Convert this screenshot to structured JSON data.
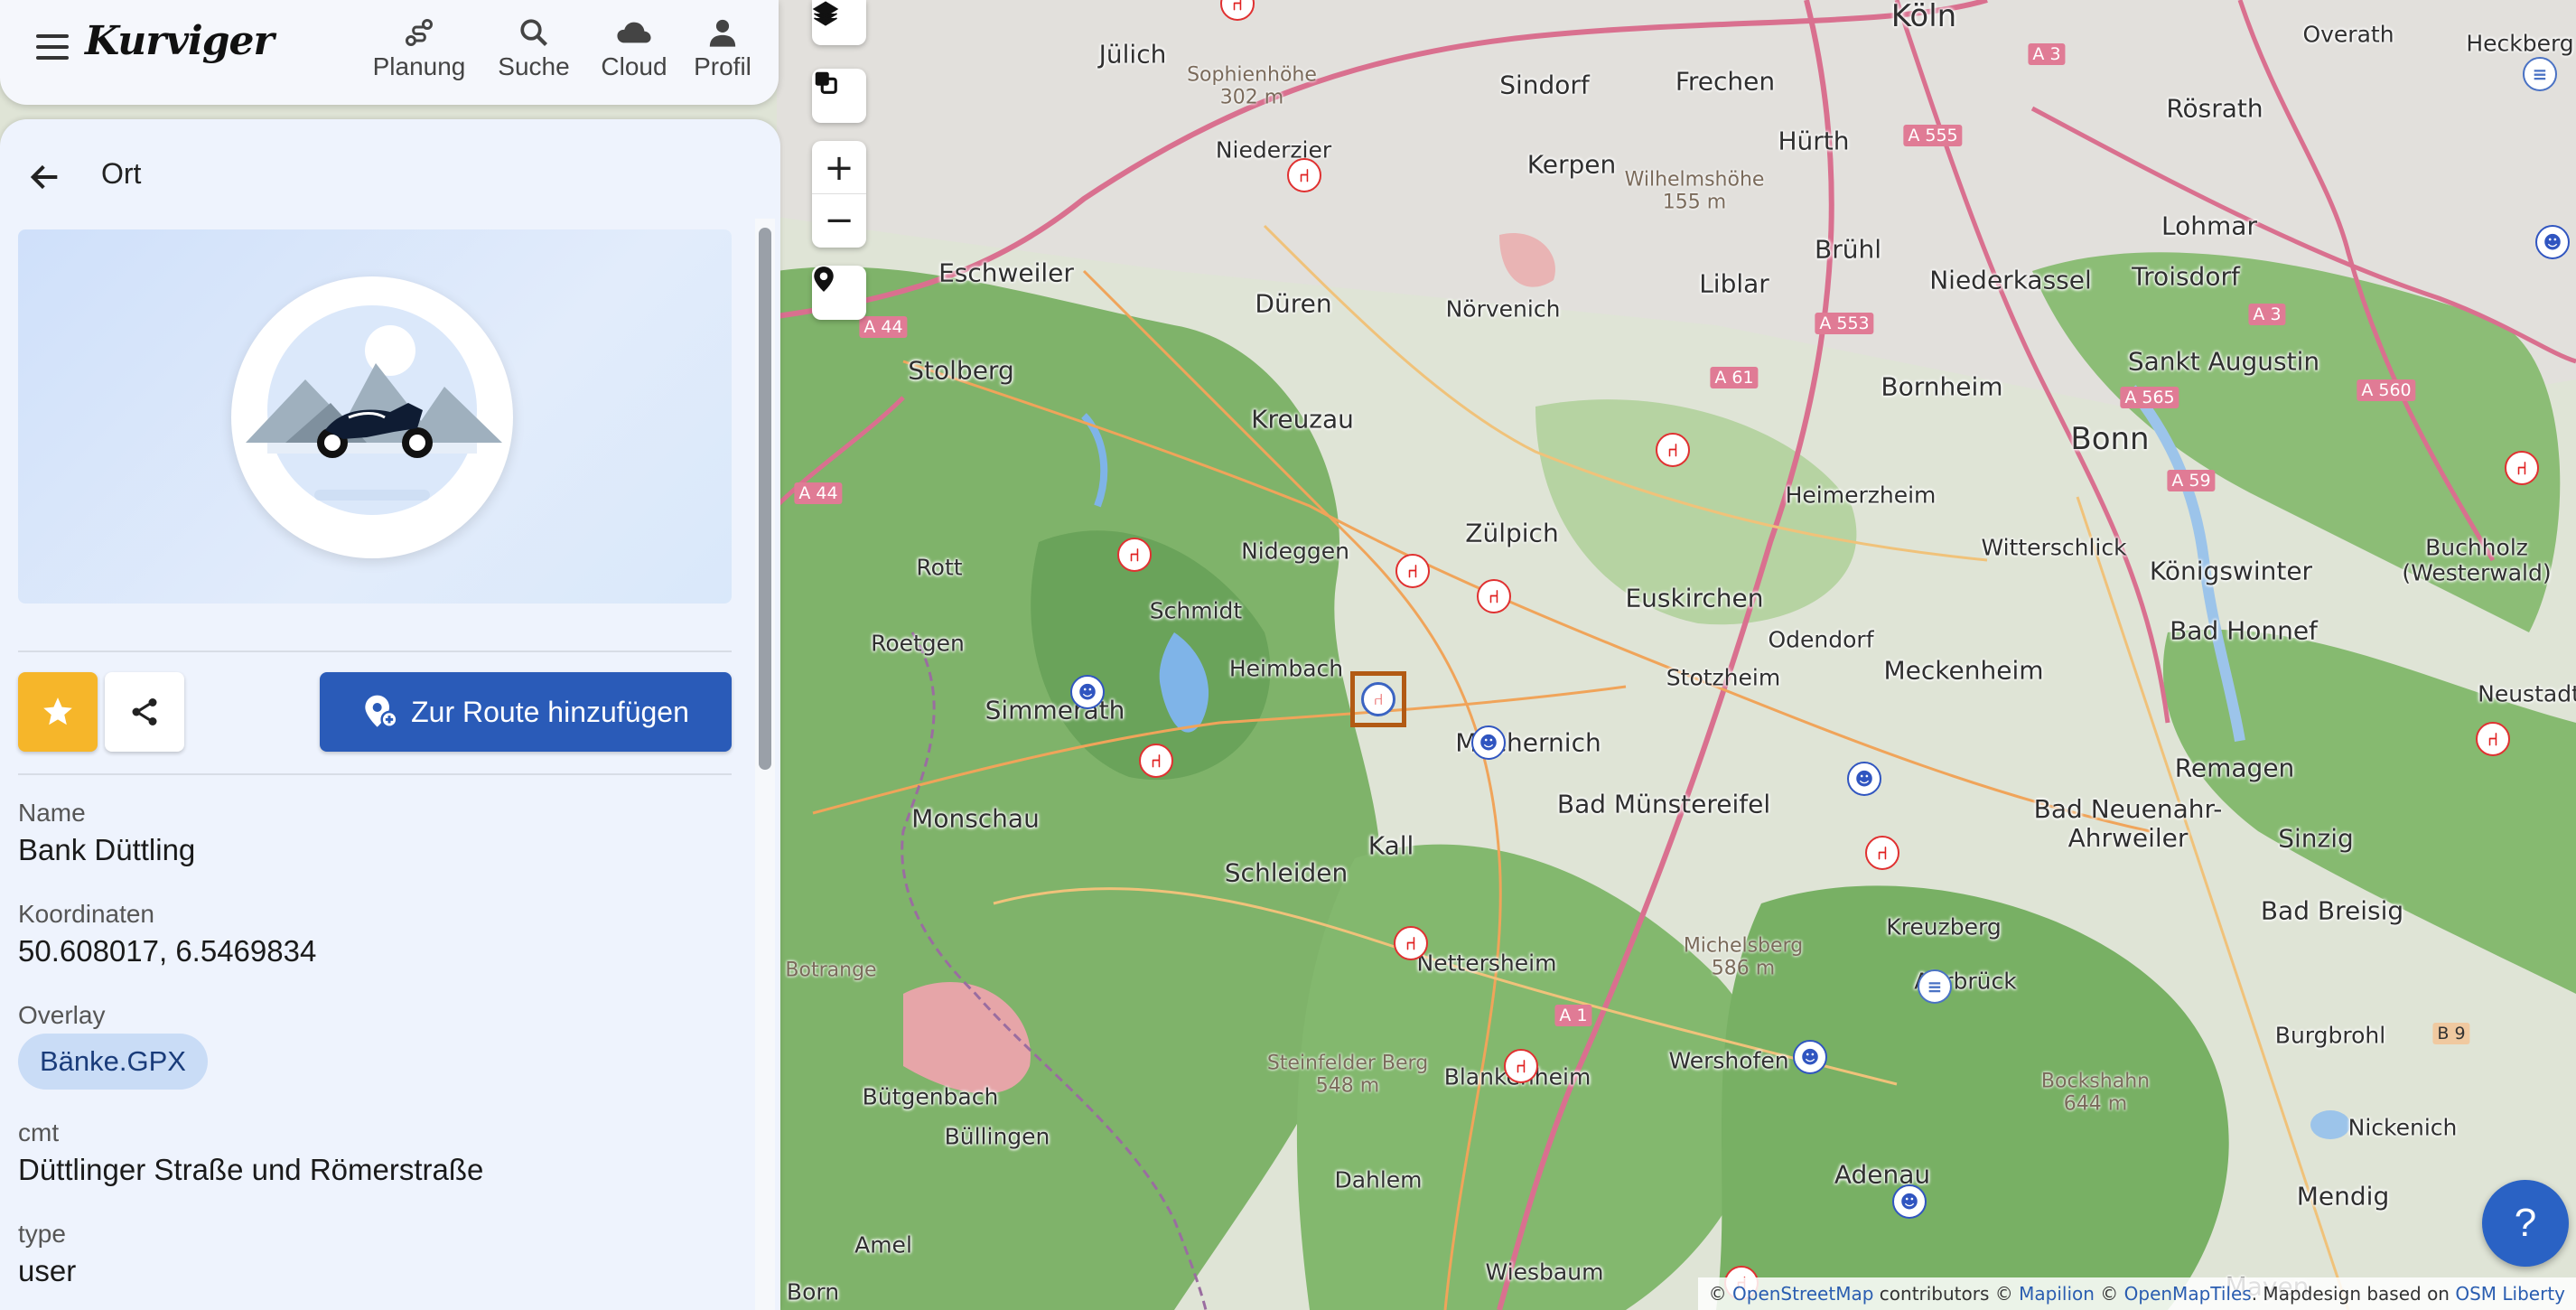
{
  "app": {
    "logo_text": "Kurviger"
  },
  "nav": {
    "items": [
      {
        "label": "Planung",
        "icon": "route-planning-icon"
      },
      {
        "label": "Suche",
        "icon": "search-icon"
      },
      {
        "label": "Cloud",
        "icon": "cloud-icon"
      },
      {
        "label": "Profil",
        "icon": "person-icon"
      }
    ]
  },
  "panel": {
    "title": "Ort",
    "add_route_label": "Zur Route hinzufügen",
    "fields": {
      "name_label": "Name",
      "name_value": "Bank Düttling",
      "coords_label": "Koordinaten",
      "coords_value": "50.608017, 6.5469834",
      "overlay_label": "Overlay",
      "overlay_chip": "Bänke.GPX",
      "cmt_label": "cmt",
      "cmt_value": "Düttlinger Straße und Römerstraße",
      "type_label": "type",
      "type_value": "user"
    },
    "colors": {
      "favorite": "#f6b62a",
      "primary": "#2a5bb8"
    }
  },
  "map": {
    "cities": [
      {
        "name": "Köln",
        "size": "big"
      },
      {
        "name": "Jülich",
        "size": "mid"
      },
      {
        "name": "Overath",
        "size": "sm"
      },
      {
        "name": "Heckberg",
        "size": "sm"
      },
      {
        "name": "Sindorf",
        "size": "mid"
      },
      {
        "name": "Frechen",
        "size": "mid"
      },
      {
        "name": "Rösrath",
        "size": "mid"
      },
      {
        "name": "Niederzier",
        "size": "sm"
      },
      {
        "name": "Kerpen",
        "size": "mid"
      },
      {
        "name": "Hürth",
        "size": "mid"
      },
      {
        "name": "Lohmar",
        "size": "mid"
      },
      {
        "name": "Eschweiler",
        "size": "mid"
      },
      {
        "name": "Düren",
        "size": "mid"
      },
      {
        "name": "Nörvenich",
        "size": "sm"
      },
      {
        "name": "Liblar",
        "size": "mid"
      },
      {
        "name": "Brühl",
        "size": "mid"
      },
      {
        "name": "Niederkassel",
        "size": "mid"
      },
      {
        "name": "Troisdorf",
        "size": "mid"
      },
      {
        "name": "Stolberg",
        "size": "mid"
      },
      {
        "name": "Sankt Augustin",
        "size": "mid"
      },
      {
        "name": "Kreuzau",
        "size": "mid"
      },
      {
        "name": "Bornheim",
        "size": "mid"
      },
      {
        "name": "Bonn",
        "size": "big"
      },
      {
        "name": "Heimerzheim",
        "size": "sm"
      },
      {
        "name": "Nideggen",
        "size": "sm"
      },
      {
        "name": "Zülpich",
        "size": "mid"
      },
      {
        "name": "Witterschlick",
        "size": "sm"
      },
      {
        "name": "Buchholz (Westerwald)",
        "size": "sm"
      },
      {
        "name": "Rott",
        "size": "sm"
      },
      {
        "name": "Schmidt",
        "size": "sm"
      },
      {
        "name": "Euskirchen",
        "size": "mid"
      },
      {
        "name": "Königswinter",
        "size": "mid"
      },
      {
        "name": "Odendorf",
        "size": "sm"
      },
      {
        "name": "Roetgen",
        "size": "sm"
      },
      {
        "name": "Heimbach",
        "size": "sm"
      },
      {
        "name": "Bad Honnef",
        "size": "mid"
      },
      {
        "name": "Stotzheim",
        "size": "sm"
      },
      {
        "name": "Meckenheim",
        "size": "mid"
      },
      {
        "name": "Simmerath",
        "size": "mid"
      },
      {
        "name": "Mechernich",
        "size": "mid"
      },
      {
        "name": "Neustadt",
        "size": "sm"
      },
      {
        "name": "Remagen",
        "size": "mid"
      },
      {
        "name": "Bad Münstereifel",
        "size": "mid"
      },
      {
        "name": "Monschau",
        "size": "mid"
      },
      {
        "name": "Bad Neuenahr-Ahrweiler",
        "size": "mid"
      },
      {
        "name": "Kall",
        "size": "mid"
      },
      {
        "name": "Sinzig",
        "size": "mid"
      },
      {
        "name": "Schleiden",
        "size": "mid"
      },
      {
        "name": "Bad Breisig",
        "size": "mid"
      },
      {
        "name": "Kreuzberg",
        "size": "sm"
      },
      {
        "name": "Nettersheim",
        "size": "sm"
      },
      {
        "name": "Burgbrohl",
        "size": "sm"
      },
      {
        "name": "Bütgenbach",
        "size": "sm"
      },
      {
        "name": "Wershofen",
        "size": "sm"
      },
      {
        "name": "Nickenich",
        "size": "sm"
      },
      {
        "name": "Büllingen",
        "size": "sm"
      },
      {
        "name": "Dahlem",
        "size": "sm"
      },
      {
        "name": "Adenau",
        "size": "mid"
      },
      {
        "name": "Mendig",
        "size": "mid"
      },
      {
        "name": "Amel",
        "size": "sm"
      },
      {
        "name": "Wiesbaum",
        "size": "sm"
      },
      {
        "name": "Born",
        "size": "sm"
      },
      {
        "name": "Mayen",
        "size": "mid"
      },
      {
        "name": "Blankenheim",
        "size": "sm"
      },
      {
        "name": "Ahrbrück",
        "size": "sm"
      }
    ],
    "peaks": [
      "Sophienhöhe\n302 m",
      "Wilhelmshöhe\n155 m",
      "Michelsberg\n586 m",
      "Steinfelder Berg\n548 m",
      "Bockshahn\n644 m",
      "Botrange"
    ],
    "roads": [
      "A 3",
      "A 555",
      "A 44",
      "A 553",
      "A 61",
      "A 565",
      "A 560",
      "A 59",
      "A 1",
      "B 9",
      "A 3",
      "A 44"
    ],
    "attribution": {
      "prefix": "© ",
      "osm": "OpenStreetMap",
      "mid": " contributors © ",
      "mapilion": "Mapilion",
      "mid2": " © ",
      "omt": "OpenMapTiles",
      "mid3": ". Mapdesign based on ",
      "osmlib": "OSM Liberty"
    },
    "help_label": "?"
  }
}
